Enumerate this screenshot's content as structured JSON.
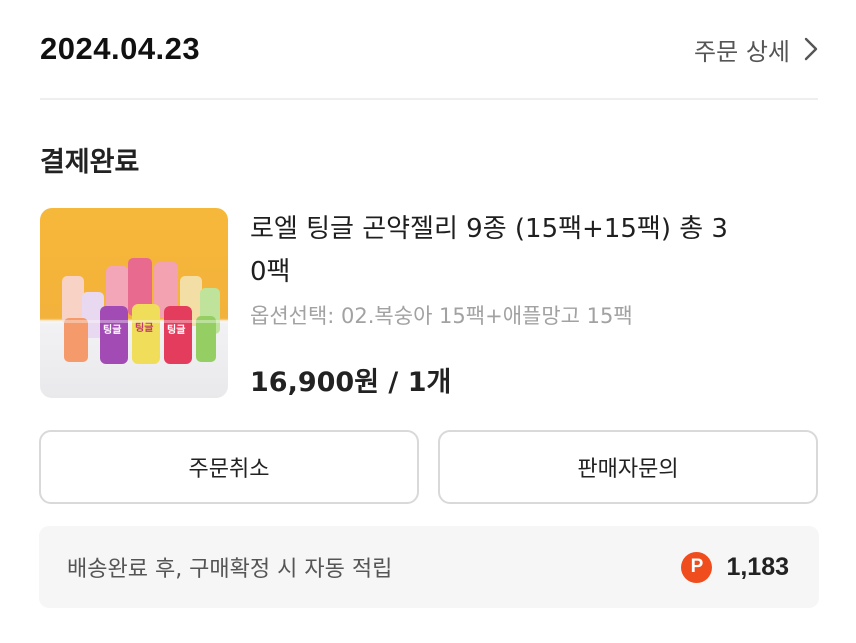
{
  "header": {
    "date": "2024.04.23",
    "detail_link": "주문 상세",
    "chevron_icon": "chevron-right-icon"
  },
  "order": {
    "status": "결제완료"
  },
  "product": {
    "name_line1": "로엘 팅글 곤약젤리 9종 (15팩+15팩) 총 3",
    "name_line2": "0팩",
    "option": "옵션선택: 02.복숭아 15팩+애플망고 15팩",
    "price": "16,900원 / 1개",
    "thumbnail_pouch_label": "팅글",
    "colors": {
      "thumb_bg_top": "#f4b634",
      "thumb_bg_bottom": "#f1f1f3"
    }
  },
  "buttons": {
    "cancel": "주문취소",
    "inquiry": "판매자문의"
  },
  "points": {
    "text": "배송완료 후, 구매확정 시 자동 적립",
    "icon_letter": "P",
    "amount": "1,183",
    "icon_color": "#ef4d1e"
  }
}
